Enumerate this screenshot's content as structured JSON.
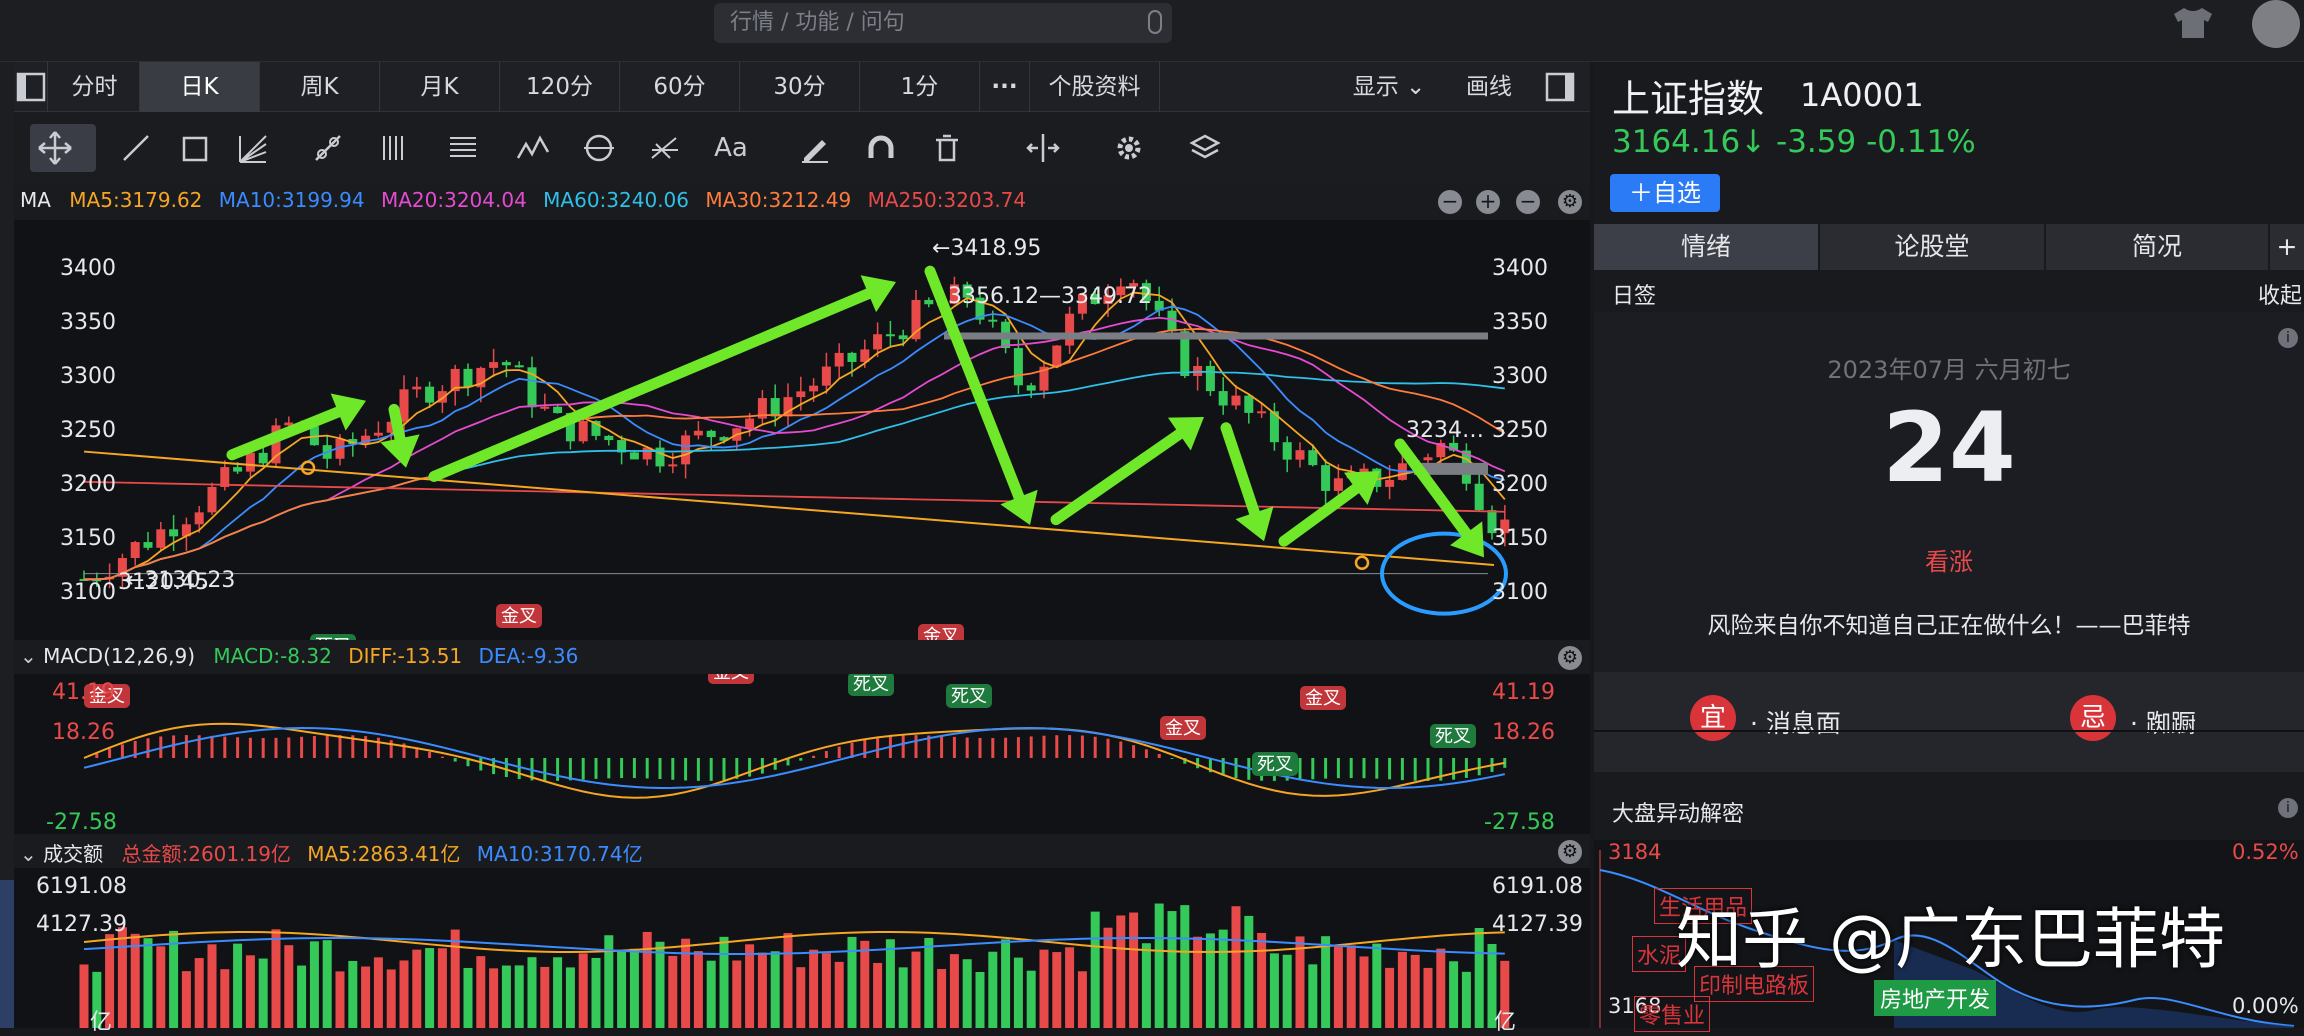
{
  "search": {
    "placeholder": "行情 / 功能 / 问句"
  },
  "tabs": [
    "分时",
    "日K",
    "周K",
    "月K",
    "120分",
    "60分",
    "30分",
    "1分",
    "个股资料"
  ],
  "tab_more": "···",
  "display_label": "显示",
  "draw_label": "画线",
  "toolbar_icons": [
    "move-icon",
    "line-icon",
    "crop-icon",
    "fan-icon",
    "node-icon",
    "grid-lines-icon",
    "text-lines-icon",
    "zigzag-icon",
    "cycle-icon",
    "fib-icon",
    "text-icon",
    "pen-icon",
    "magnet-icon",
    "trash-icon",
    "split-icon",
    "gear-icon",
    "layers-icon"
  ],
  "toolbar_text_label": "Aa",
  "ma": {
    "label": "MA",
    "items": [
      {
        "text": "MA5:3179.62",
        "color": "#f5a623"
      },
      {
        "text": "MA10:3199.94",
        "color": "#3b8cff"
      },
      {
        "text": "MA20:3204.04",
        "color": "#e54bd0"
      },
      {
        "text": "MA60:3240.06",
        "color": "#2ec0e8"
      },
      {
        "text": "MA30:3212.49",
        "color": "#ff7c3a"
      },
      {
        "text": "MA250:3203.74",
        "color": "#e84a4a"
      }
    ]
  },
  "price_axis": [
    "3400",
    "3350",
    "3300",
    "3250",
    "3200",
    "3150",
    "3100"
  ],
  "annotations": {
    "high": "←3418.95",
    "range": "3356.12—3349.72",
    "right_level": "3234…",
    "low": "←3130.23",
    "low_overlap": "3120.45"
  },
  "macd": {
    "label": "MACD(12,26,9)",
    "items": [
      {
        "text": "MACD:-8.32",
        "color": "#35c95a"
      },
      {
        "text": "DIFF:-13.51",
        "color": "#f5a623"
      },
      {
        "text": "DEA:-9.36",
        "color": "#3b8cff"
      }
    ],
    "axis": [
      "41.19",
      "18.26",
      "-27.58"
    ],
    "golden": "金叉",
    "dead": "死叉"
  },
  "volume": {
    "label": "成交额",
    "items": [
      {
        "text": "总金额:2601.19亿",
        "color": "#e84a4a"
      },
      {
        "text": "MA5:2863.41亿",
        "color": "#f5a623"
      },
      {
        "text": "MA10:3170.74亿",
        "color": "#3b8cff"
      }
    ],
    "axis": [
      "6191.08",
      "4127.39",
      "亿"
    ]
  },
  "right": {
    "title": "上证指数",
    "code": "1A0001",
    "price": "3164.16↓ -3.59 -0.11%",
    "add": "＋自选",
    "tabs": [
      "情绪",
      "论股堂",
      "简况"
    ],
    "plus": "+",
    "daily_label": "日签",
    "collapse": "收起",
    "date": "2023年07月 六月初七",
    "day": "24",
    "outlook": "看涨",
    "quote": "风险来自你不知道自己正在做什么！——巴菲特",
    "yi": "宜",
    "yi_text": "· 消息面",
    "ji": "忌",
    "ji_text": "· 踟蹰",
    "anomaly": "大盘异动解密",
    "chart_top": "3184",
    "chart_top_pct": "0.52%",
    "chart_bottom": "3168",
    "chart_bottom_pct": "0.00%",
    "tags": [
      "生活用品",
      "水泥",
      "印制电路板",
      "房地产开发",
      "零售业"
    ],
    "watermark": "知乎 @广东巴菲特"
  },
  "colors": {
    "up": "#e84a4a",
    "down": "#35c95a",
    "arrow": "#6fe82a",
    "accent": "#2a7bf5"
  }
}
